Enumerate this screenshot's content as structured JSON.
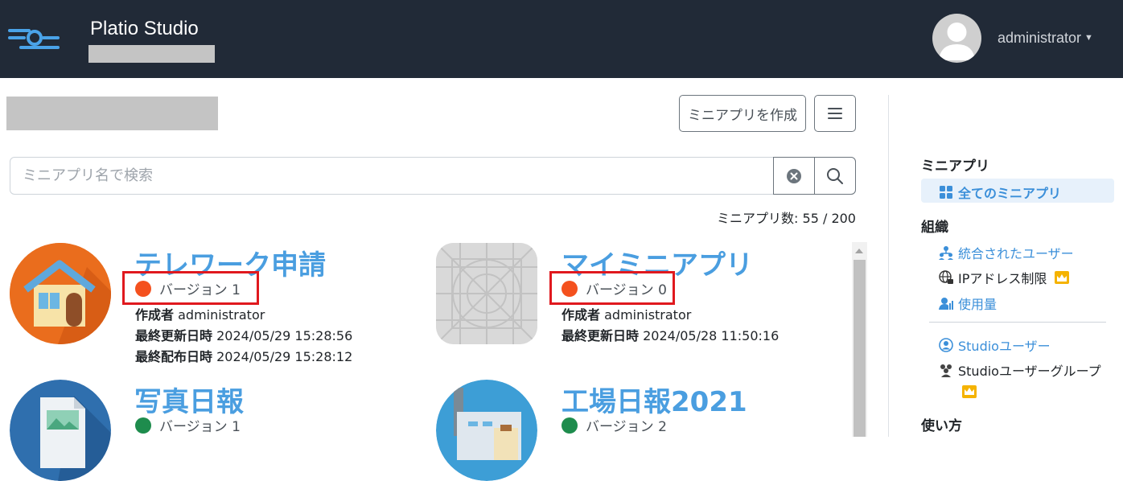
{
  "header": {
    "app_title": "Platio Studio",
    "user_name": "administrator",
    "logo_icon": "platio-logo-icon",
    "avatar_icon": "user-avatar-icon"
  },
  "toolbar": {
    "create_label": "ミニアプリを作成",
    "menu_icon": "hamburger-icon"
  },
  "search": {
    "placeholder": "ミニアプリ名で検索",
    "value": "",
    "clear_icon": "clear-icon",
    "search_icon": "search-icon"
  },
  "count": {
    "label": "ミニアプリ数: 55 / 200"
  },
  "apps": [
    {
      "name": "テレワーク申請",
      "version": "バージョン 1",
      "status_color": "#f4511e",
      "highlighted": true,
      "author_label": "作成者",
      "author": "administrator",
      "updated_label": "最終更新日時",
      "updated": "2024/05/29 15:28:56",
      "deployed_label": "最終配布日時",
      "deployed": "2024/05/29 15:28:12",
      "icon": "house-icon"
    },
    {
      "name": "マイミニアプリ",
      "version": "バージョン 0",
      "status_color": "#f4511e",
      "highlighted": true,
      "author_label": "作成者",
      "author": "administrator",
      "updated_label": "最終更新日時",
      "updated": "2024/05/28 11:50:16",
      "icon": "placeholder-grid-icon"
    },
    {
      "name": "写真日報",
      "version": "バージョン 1",
      "status_color": "#1e8c4d",
      "highlighted": false,
      "icon": "photo-document-icon"
    },
    {
      "name": "工場日報2021",
      "version": "バージョン 2",
      "status_color": "#1e8c4d",
      "highlighted": false,
      "icon": "factory-icon"
    }
  ],
  "sidebar": {
    "section_miniapp": "ミニアプリ",
    "all_miniapps": "全てのミニアプリ",
    "section_org": "組織",
    "integrated_users": "統合されたユーザー",
    "ip_restriction": "IPアドレス制限",
    "usage": "使用量",
    "studio_users": "Studioユーザー",
    "studio_user_groups": "Studioユーザーグループ",
    "section_howto": "使い方"
  },
  "colors": {
    "header_bg": "#212a37",
    "accent": "#3b8fd9",
    "highlight_border": "#e0191e",
    "premium": "#f5b301"
  }
}
